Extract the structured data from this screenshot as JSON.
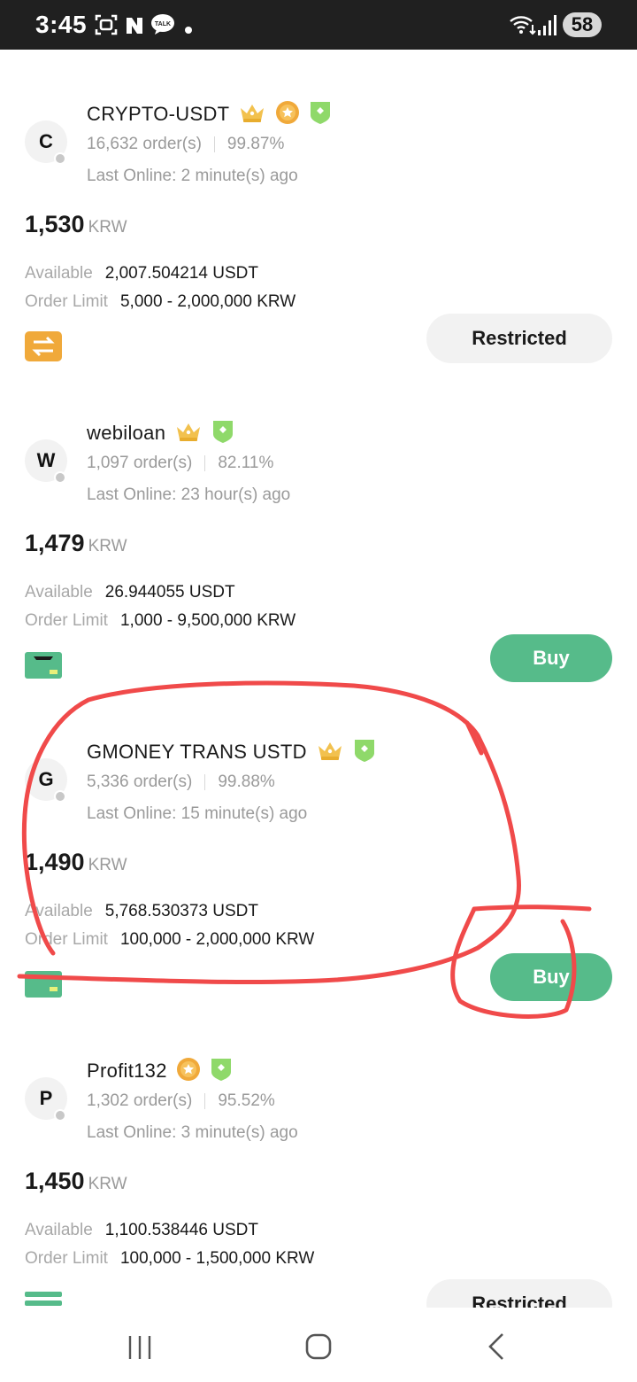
{
  "status_bar": {
    "time": "3:45",
    "icons": [
      "screenshot-icon",
      "naver-icon",
      "kakaotalk-icon",
      "notification-dot-icon"
    ],
    "kakao_label": "TALK",
    "battery": "58"
  },
  "colors": {
    "buy_button": "#56bb8a",
    "restricted_button": "#f2f2f2",
    "annotation": "#f04a4a",
    "muted_text": "#9a9a9a"
  },
  "labels": {
    "available": "Available",
    "order_limit": "Order Limit"
  },
  "merchants": [
    {
      "initial": "C",
      "name": "CRYPTO-USDT",
      "badges": [
        "crown-icon",
        "gold-medal-icon",
        "verified-shield-icon"
      ],
      "orders": "16,632 order(s)",
      "completion": "99.87%",
      "last_online": "Last Online: 2 minute(s) ago",
      "price": "1,530",
      "currency": "KRW",
      "available": "2,007.504214 USDT",
      "order_limit": "5,000 - 2,000,000 KRW",
      "payment_icon": "bank-transfer-icon",
      "action": "Restricted"
    },
    {
      "initial": "W",
      "name": "webiloan",
      "badges": [
        "crown-icon",
        "verified-shield-icon"
      ],
      "orders": "1,097 order(s)",
      "completion": "82.11%",
      "last_online": "Last Online: 23 hour(s) ago",
      "price": "1,479",
      "currency": "KRW",
      "available": "26.944055 USDT",
      "order_limit": "1,000 - 9,500,000 KRW",
      "payment_icon": "bank-card-icon",
      "action": "Buy"
    },
    {
      "initial": "G",
      "name": "GMONEY TRANS USTD",
      "badges": [
        "crown-icon",
        "verified-shield-icon"
      ],
      "orders": "5,336 order(s)",
      "completion": "99.88%",
      "last_online": "Last Online: 15 minute(s) ago",
      "price": "1,490",
      "currency": "KRW",
      "available": "5,768.530373 USDT",
      "order_limit": "100,000 - 2,000,000 KRW",
      "payment_icon": "bank-card-icon",
      "action": "Buy"
    },
    {
      "initial": "P",
      "name": "Profit132",
      "badges": [
        "gold-medal-icon",
        "verified-shield-icon"
      ],
      "orders": "1,302 order(s)",
      "completion": "95.52%",
      "last_online": "Last Online: 3 minute(s) ago",
      "price": "1,450",
      "currency": "KRW",
      "available": "1,100.538446 USDT",
      "order_limit": "100,000 - 1,500,000 KRW",
      "payment_icon": "bank-stripes-icon",
      "action": "Restricted"
    }
  ],
  "nav_bar": {
    "buttons": [
      "recent-apps-icon",
      "home-icon",
      "back-icon"
    ]
  }
}
